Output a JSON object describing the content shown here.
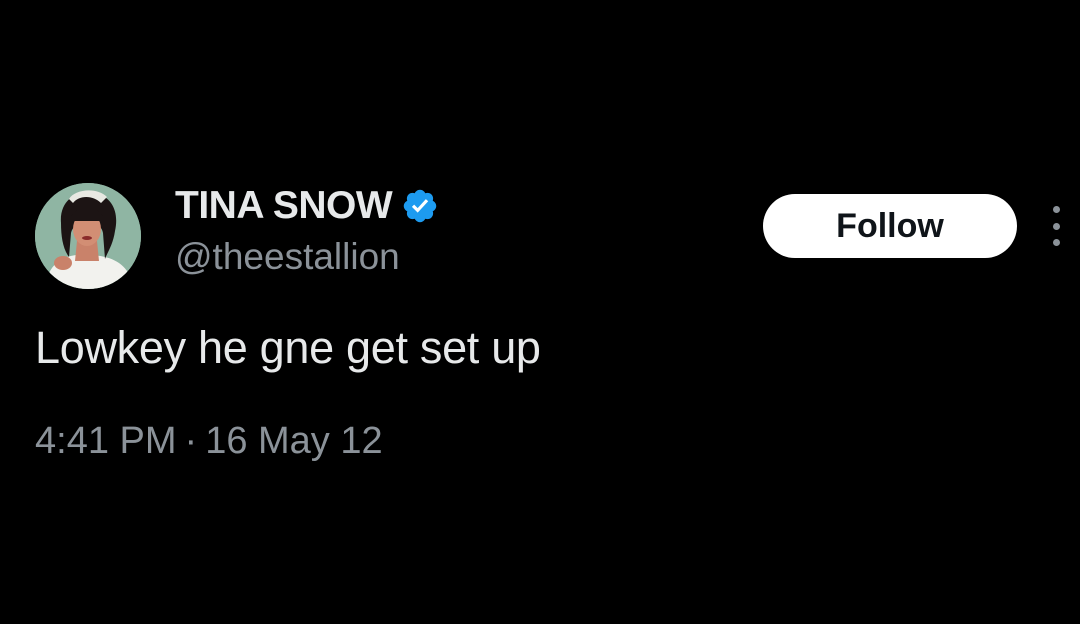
{
  "tweet": {
    "author": {
      "display_name": "TINA SNOW",
      "handle": "@theestallion",
      "verified": true,
      "verified_color": "#1d9bf0",
      "avatar_icon": "profile-photo"
    },
    "follow_label": "Follow",
    "more_icon": "vertical-ellipsis-icon",
    "text": "Lowkey he gne get set up",
    "time": "4:41 PM",
    "separator": "·",
    "date": "16 May 12"
  },
  "colors": {
    "background": "#000000",
    "primary_text": "#e7e9ea",
    "secondary_text": "#8b9299",
    "button_bg": "#ffffff",
    "button_text": "#0f1419"
  }
}
